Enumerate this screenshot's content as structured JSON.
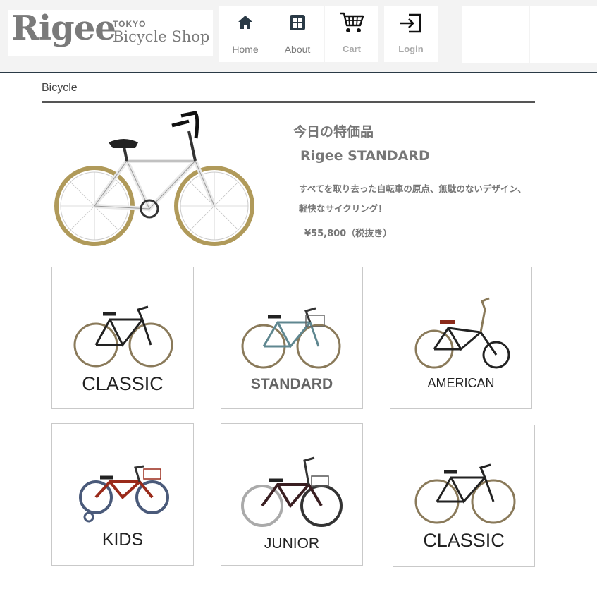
{
  "header": {
    "logo": "Rigee",
    "logo_city": "TOKYO",
    "logo_sub": "Bicycle Shop",
    "nav": [
      {
        "label": "Home",
        "icon": "home-icon"
      },
      {
        "label": "About",
        "icon": "grid-icon"
      },
      {
        "label": "Cart",
        "icon": "cart-icon"
      },
      {
        "label": "Login",
        "icon": "login-icon"
      }
    ]
  },
  "section": {
    "title": "Bicycle"
  },
  "featured": {
    "label": "今日の特価品",
    "name": "Rigee STANDARD",
    "description_line1": "すべてを取り去った自転車の原点、無駄のないデザイン、",
    "description_line2": "軽快なサイクリング！",
    "price": "¥55,800（税抜き）"
  },
  "categories": [
    {
      "label": "CLASSIC"
    },
    {
      "label": "STANDARD"
    },
    {
      "label": "AMERICAN"
    },
    {
      "label": "KIDS"
    },
    {
      "label": "JUNIOR"
    },
    {
      "label": "CLASSIC"
    }
  ],
  "colors": {
    "header_bg": "#f3f3f3",
    "header_rule": "#2a3a46",
    "nav_icon": "#2a3a46",
    "text_gray": "#777777"
  }
}
